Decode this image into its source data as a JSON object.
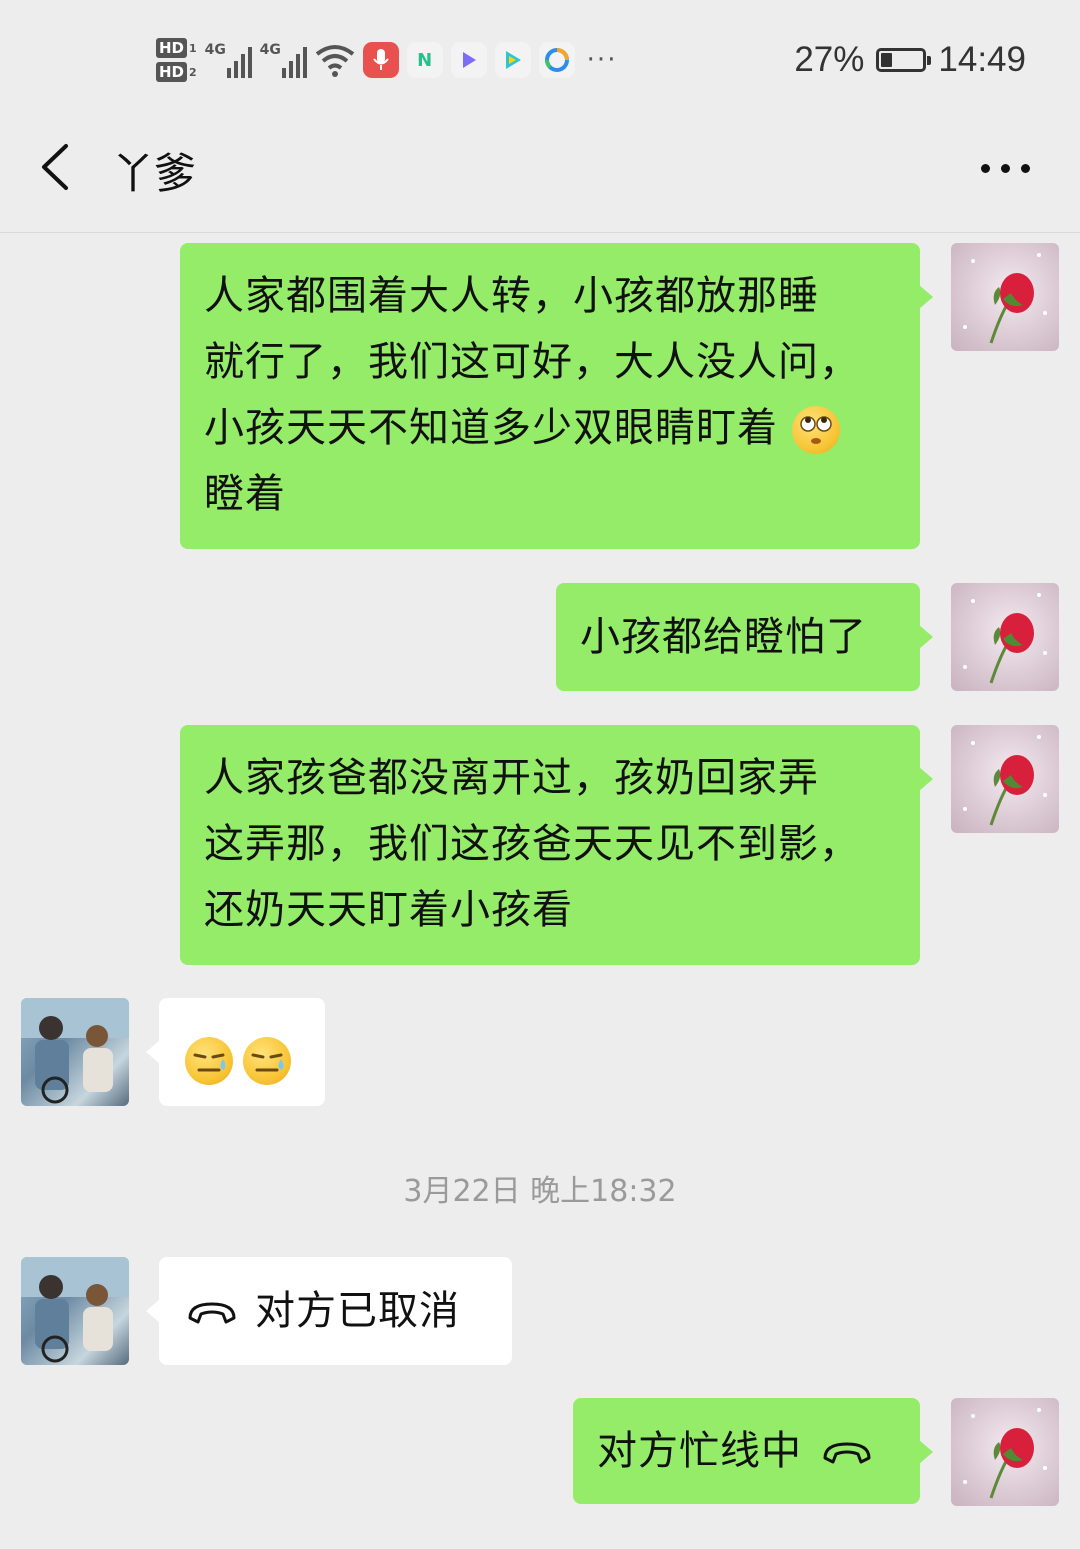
{
  "status_bar": {
    "network_1": "4G",
    "network_2": "4G",
    "hd_1": "HD",
    "hd_1_num": "1",
    "hd_2": "HD",
    "hd_2_num": "2",
    "overflow": "···",
    "battery_percent": "27%",
    "battery_level": 0.27,
    "time": "14:49",
    "app_icons": [
      "microphone-app-icon",
      "n-app-icon",
      "video-play-app-icon",
      "iqiyi-app-icon",
      "tencent-video-app-icon"
    ]
  },
  "header": {
    "title": "丫爹"
  },
  "messages": [
    {
      "sender": "me",
      "text_lines": [
        "人家都围着大人转，小孩都放那睡",
        "就行了，我们这可好，大人没人问，",
        "小孩天天不知道多少双眼睛盯着",
        "瞪着"
      ],
      "emoji": "rolling-eyes-emoji"
    },
    {
      "sender": "me",
      "text": "小孩都给瞪怕了"
    },
    {
      "sender": "me",
      "text_lines": [
        "人家孩爸都没离开过，孩奶回家弄",
        "这弄那，我们这孩爸天天见不到影，",
        "还奶天天盯着小孩看"
      ]
    },
    {
      "sender": "them",
      "emojis": [
        "sweat-smile-emoji",
        "sweat-smile-emoji"
      ]
    },
    {
      "sender": "them",
      "text": "对方已取消",
      "icon": "hang-up-icon"
    },
    {
      "sender": "me",
      "text": "对方忙线中",
      "icon": "hang-up-icon"
    }
  ],
  "timestamp": "3月22日 晚上18:32",
  "colors": {
    "background": "#ededed",
    "my_bubble": "#95ec69",
    "their_bubble": "#ffffff",
    "timestamp_text": "#9a9a9a"
  }
}
